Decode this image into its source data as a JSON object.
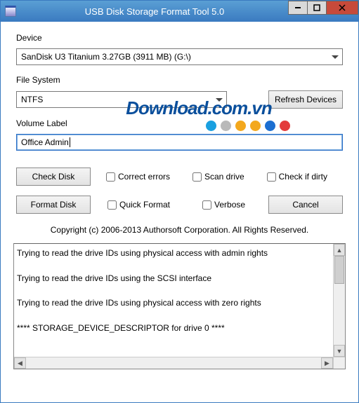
{
  "window": {
    "title": "USB Disk Storage Format Tool 5.0",
    "min": "—",
    "max": "□",
    "close": "✕"
  },
  "labels": {
    "device": "Device",
    "fileSystem": "File System",
    "volumeLabel": "Volume Label"
  },
  "device": {
    "selected": "SanDisk U3 Titanium 3.27GB (3911 MB)  (G:\\)"
  },
  "fileSystem": {
    "selected": "NTFS"
  },
  "buttons": {
    "refresh": "Refresh Devices",
    "checkDisk": "Check Disk",
    "formatDisk": "Format Disk",
    "cancel": "Cancel"
  },
  "volume": {
    "value": "Office Admin"
  },
  "checkboxes": {
    "correctErrors": "Correct errors",
    "scanDrive": "Scan drive",
    "checkIfDirty": "Check if dirty",
    "quickFormat": "Quick Format",
    "verbose": "Verbose"
  },
  "copyright": "Copyright (c) 2006-2013 Authorsoft Corporation. All Rights Reserved.",
  "watermark": {
    "text": "Download",
    "tld": ".com.vn",
    "dots": [
      "#1aa0e0",
      "#b9b9b9",
      "#f3a81d",
      "#f3a81d",
      "#1c6fd1",
      "#e33b3b"
    ]
  },
  "log": [
    "Trying to read the drive IDs using physical access with admin rights",
    "Trying to read the drive IDs using the SCSI interface",
    "Trying to read the drive IDs using physical access with zero rights",
    "**** STORAGE_DEVICE_DESCRIPTOR for drive 0 ****"
  ]
}
